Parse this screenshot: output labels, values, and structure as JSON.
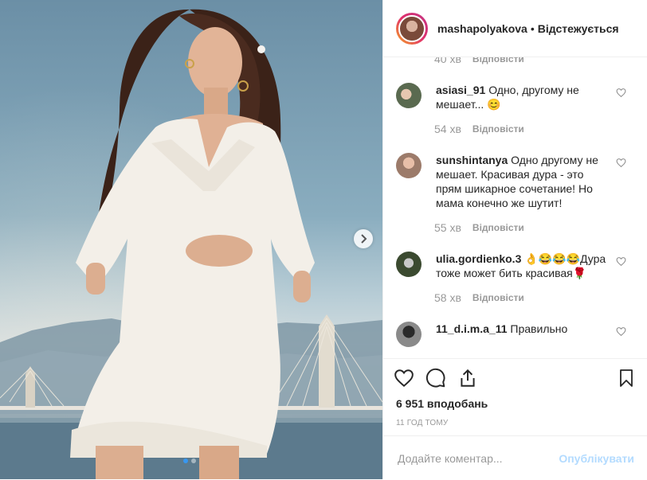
{
  "post": {
    "username": "mashapolyakova",
    "separator": "•",
    "follow_status": "Відстежується"
  },
  "first_meta": {
    "time": "40 хв",
    "reply": "Відповісти"
  },
  "comments": [
    {
      "user": "asiasi_91",
      "text": "Одно, другому не мешает... 😊",
      "time": "54 хв",
      "reply": "Відповісти"
    },
    {
      "user": "sunshintanya",
      "text": "Одно другому не мешает. Красивая дура - это прям шикарное сочетание! Но мама конечно же шутит!",
      "time": "55 хв",
      "reply": "Відповісти"
    },
    {
      "user": "ulia.gordienko.3",
      "text": "👌😂😂😂Дура тоже может бить красивая🌹",
      "time": "58 хв",
      "reply": "Відповісти"
    },
    {
      "user": "11_d.i.m.a_11",
      "text": "Правильно"
    }
  ],
  "likes": "6 951 вподобань",
  "time_ago": "11 ГОД ТОМУ",
  "add_comment": {
    "placeholder": "Додайте коментар...",
    "post_label": "Опублікувати"
  },
  "carousel": {
    "current": 1,
    "total": 2
  },
  "colors": {
    "accent": "#3897f0",
    "post_disabled": "#b3dbff",
    "muted": "#999999",
    "text": "#262626"
  },
  "icons": [
    "chevron-right-icon",
    "heart-icon",
    "comment-icon",
    "share-icon",
    "bookmark-icon"
  ]
}
